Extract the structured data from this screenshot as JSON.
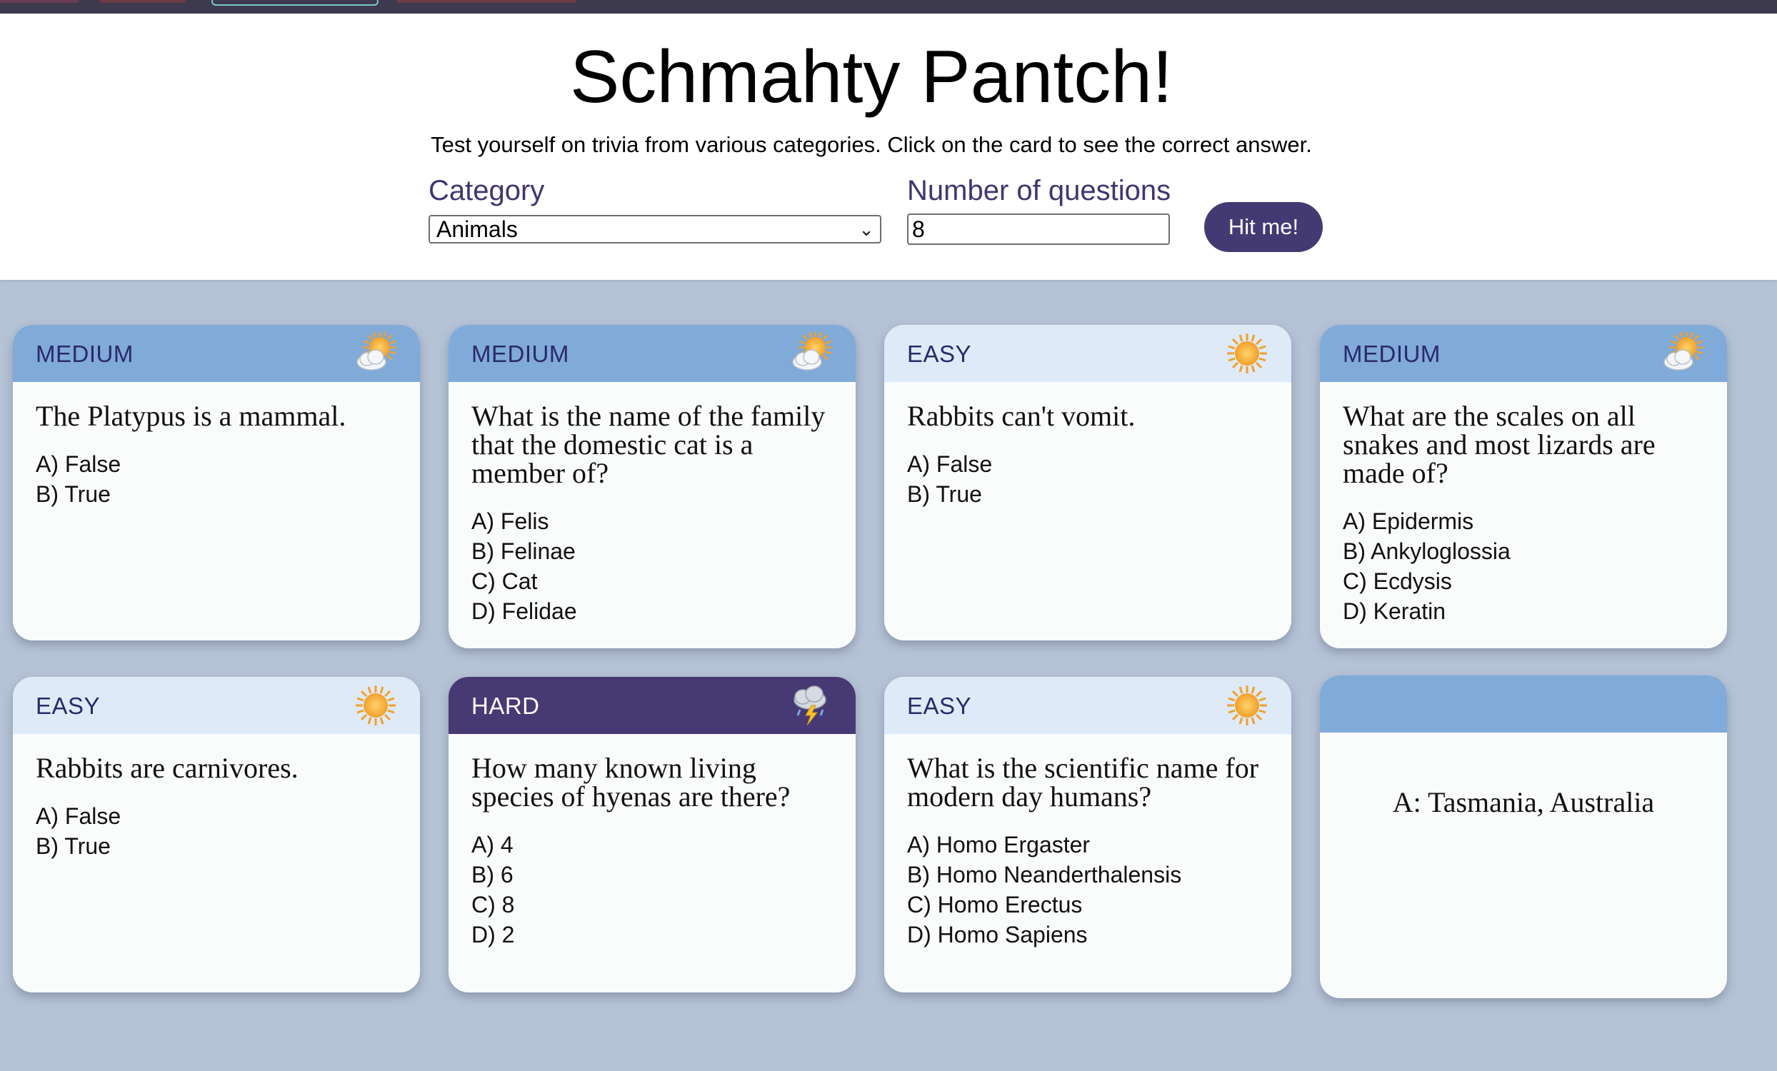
{
  "header": {
    "title": "Schmahty Pantch!",
    "subtitle": "Test yourself on trivia from various categories. Click on the card to see the correct answer."
  },
  "controls": {
    "category_label": "Category",
    "category_value": "Animals",
    "count_label": "Number of questions",
    "count_value": "8",
    "submit_label": "Hit me!"
  },
  "colors": {
    "medium": "#80aad8",
    "easy": "#deeaf8",
    "hard": "#473a74",
    "accent": "#443a73",
    "page_bg": "#b6c3d6"
  },
  "cards": [
    {
      "difficulty": "MEDIUM",
      "icon": "partly-sunny-icon",
      "question": "The Platypus is a mammal.",
      "options": [
        "A) False",
        "B) True"
      ]
    },
    {
      "difficulty": "MEDIUM",
      "icon": "partly-sunny-icon",
      "question": "What is the name of the family that the domestic cat is a member of?",
      "options": [
        "A) Felis",
        "B) Felinae",
        "C) Cat",
        "D) Felidae"
      ]
    },
    {
      "difficulty": "EASY",
      "icon": "sun-icon",
      "question": "Rabbits can't vomit.",
      "options": [
        "A) False",
        "B) True"
      ]
    },
    {
      "difficulty": "MEDIUM",
      "icon": "partly-sunny-icon",
      "question": "What are the scales on all snakes and most lizards are made of?",
      "options": [
        "A) Epidermis",
        "B) Ankyloglossia",
        "C) Ecdysis",
        "D) Keratin"
      ]
    },
    {
      "difficulty": "EASY",
      "icon": "sun-icon",
      "question": "Rabbits are carnivores.",
      "options": [
        "A) False",
        "B) True"
      ]
    },
    {
      "difficulty": "HARD",
      "icon": "thunderstorm-icon",
      "question": "How many known living species of hyenas are there?",
      "options": [
        "A) 4",
        "B) 6",
        "C) 8",
        "D) 2"
      ]
    },
    {
      "difficulty": "EASY",
      "icon": "sun-icon",
      "question": "What is the scientific name for modern day humans?",
      "options": [
        "A) Homo Ergaster",
        "B) Homo Neanderthalensis",
        "C) Homo Erectus",
        "D) Homo Sapiens"
      ]
    },
    {
      "difficulty": "",
      "icon": "",
      "answer": "A: Tasmania, Australia"
    }
  ]
}
